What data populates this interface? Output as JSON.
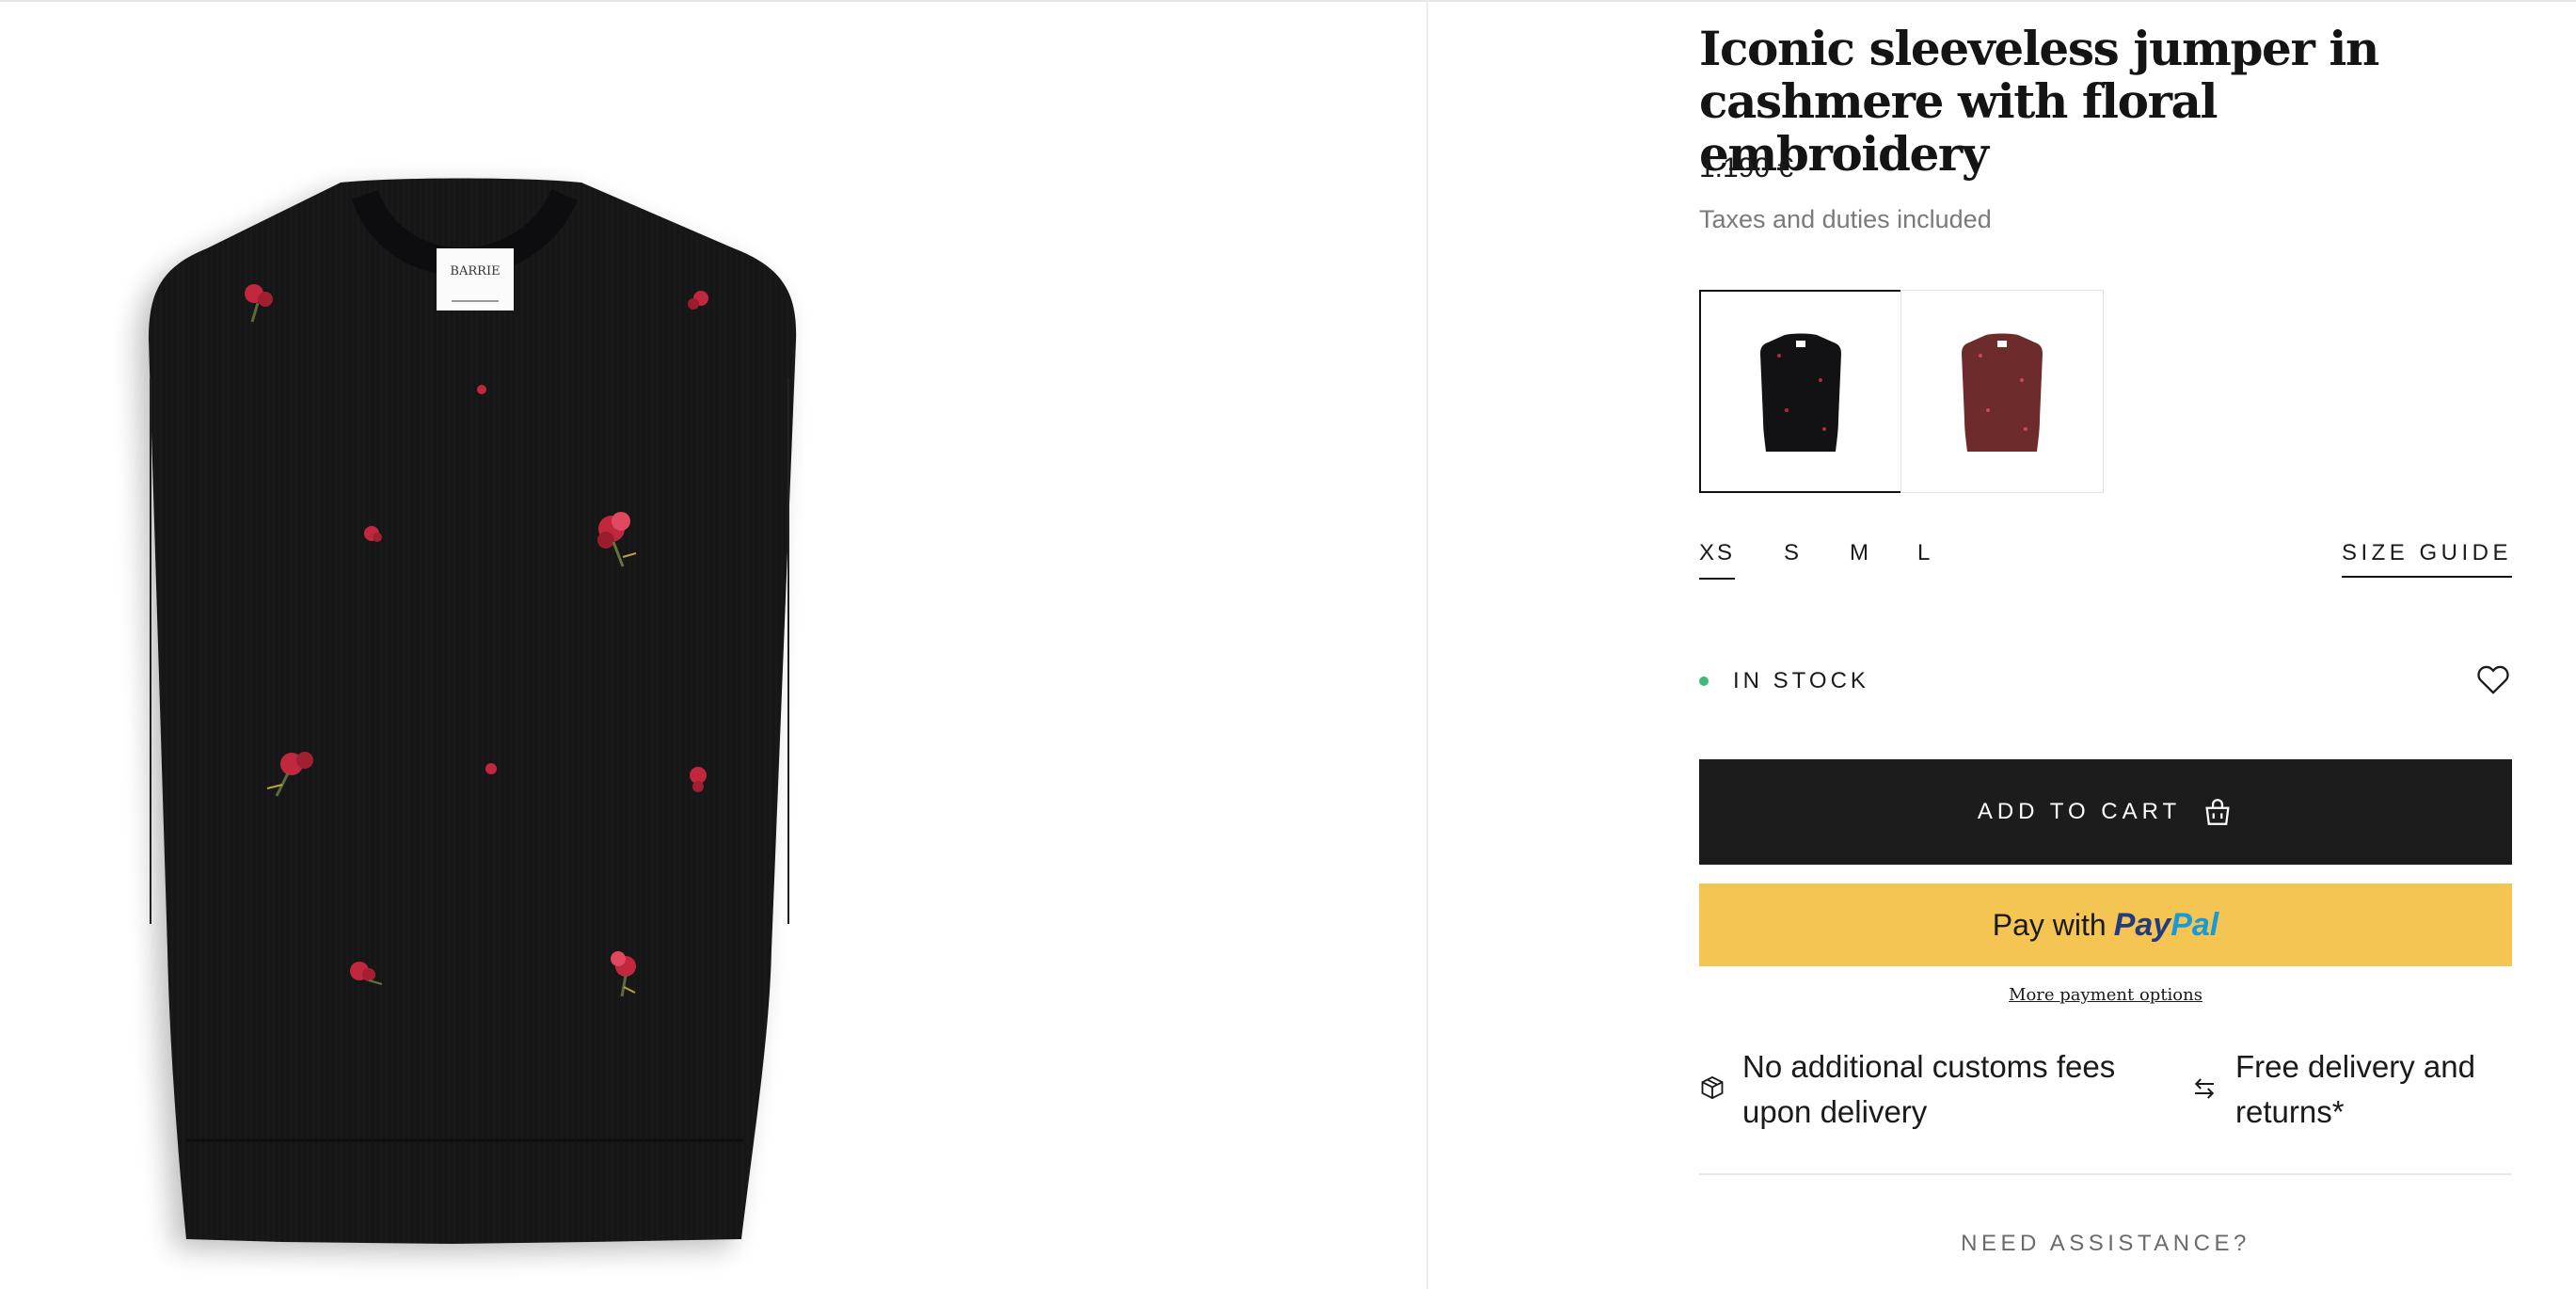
{
  "product": {
    "title": "Iconic sleeveless jumper in cashmere with floral embroidery",
    "price": "1.190 €",
    "taxes_note": "Taxes and duties included",
    "label_brand": "BARRIE",
    "colors": [
      {
        "name": "black",
        "hex": "#121215",
        "selected": true
      },
      {
        "name": "burgundy",
        "hex": "#6e2b2b",
        "selected": false
      }
    ],
    "sizes": [
      "XS",
      "S",
      "M",
      "L"
    ],
    "selected_size": "XS",
    "size_guide_label": "SIZE GUIDE",
    "stock_label": "IN STOCK",
    "stock_color": "#3dbb73"
  },
  "actions": {
    "add_to_cart": "ADD TO CART",
    "paypal_prefix": "Pay with",
    "paypal_brand_1": "Pay",
    "paypal_brand_2": "Pal",
    "more_payment": "More payment options"
  },
  "perks": [
    {
      "icon": "box-icon",
      "text": "No additional customs fees upon delivery"
    },
    {
      "icon": "exchange-arrows-icon",
      "text": "Free delivery and returns*"
    }
  ],
  "assistance": {
    "heading": "NEED ASSISTANCE?"
  },
  "icons": {
    "wishlist": "heart-icon",
    "cart": "shopping-bag-icon"
  },
  "colors": {
    "button_dark": "#1c1c1c",
    "paypal_yellow": "#f5c554",
    "paypal_navy": "#253b80",
    "paypal_blue": "#179bd7"
  }
}
